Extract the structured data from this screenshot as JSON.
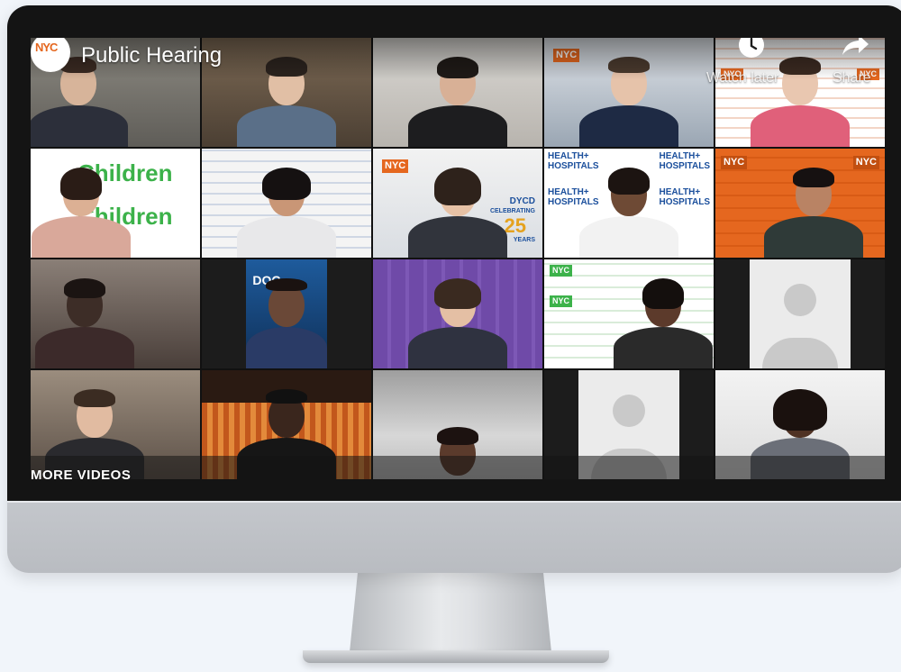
{
  "player": {
    "title": "Public Hearing",
    "watch_later_label": "Watch later",
    "share_label": "Share",
    "more_videos_label": "MORE VIDEOS",
    "channel_logo_text": "NYC"
  },
  "backdrops": {
    "children_word": "Children",
    "nyc": "NYC",
    "doc": "DOC",
    "dycd": "DYCD",
    "celebrating": "CELEBRATING",
    "years_number": "25",
    "years": "YEARS",
    "health_hospitals_line1": "HEALTH+",
    "health_hospitals_line2": "HOSPITALS"
  },
  "colors": {
    "nyc_orange": "#e5671f",
    "children_green": "#3cb24a",
    "dycd_purple": "#6f4aa8",
    "hh_blue": "#1b4f9c",
    "screen_black": "#141414",
    "monitor_silver": "#c9ccd0"
  },
  "icons": {
    "watch_later": "clock-icon",
    "share": "share-arrow-icon",
    "channel": "nyc-logo-icon",
    "avatar": "default-user-avatar-icon"
  }
}
